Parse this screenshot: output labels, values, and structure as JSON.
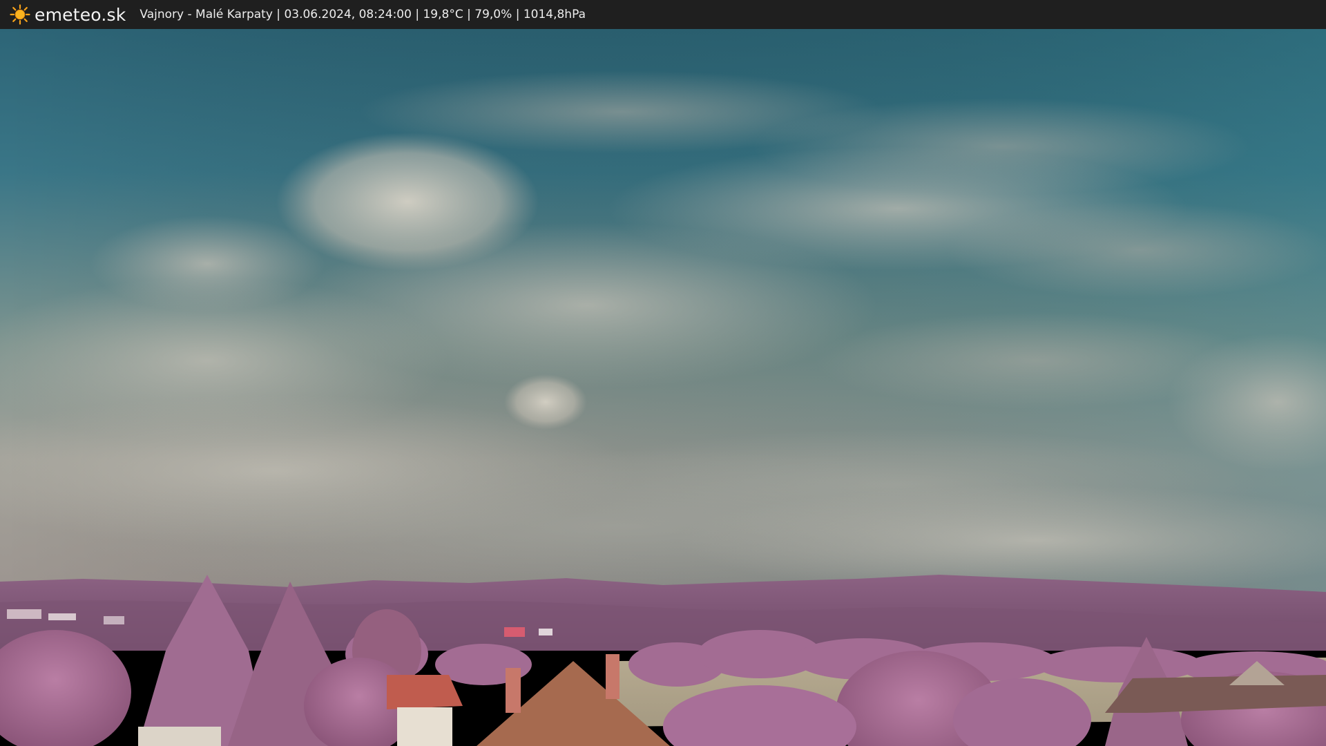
{
  "header": {
    "brand": "emeteo.sk",
    "location": "Vajnory - Malé Karpaty",
    "datetime": "03.06.2024, 08:24:00",
    "temperature": "19,8°C",
    "humidity": "79,0%",
    "pressure": "1014,8hPa",
    "sep": "|"
  },
  "icons": {
    "brand_icon": "sun-icon"
  },
  "colors": {
    "bar_bg": "#1f1f1f",
    "sun": "#f7a21a",
    "sky_top": "#2e6b7a",
    "cloud": "#c9c2b6",
    "hills": "#8a5c7e",
    "trees": "#a86a93",
    "field": "#b9ab8e"
  }
}
